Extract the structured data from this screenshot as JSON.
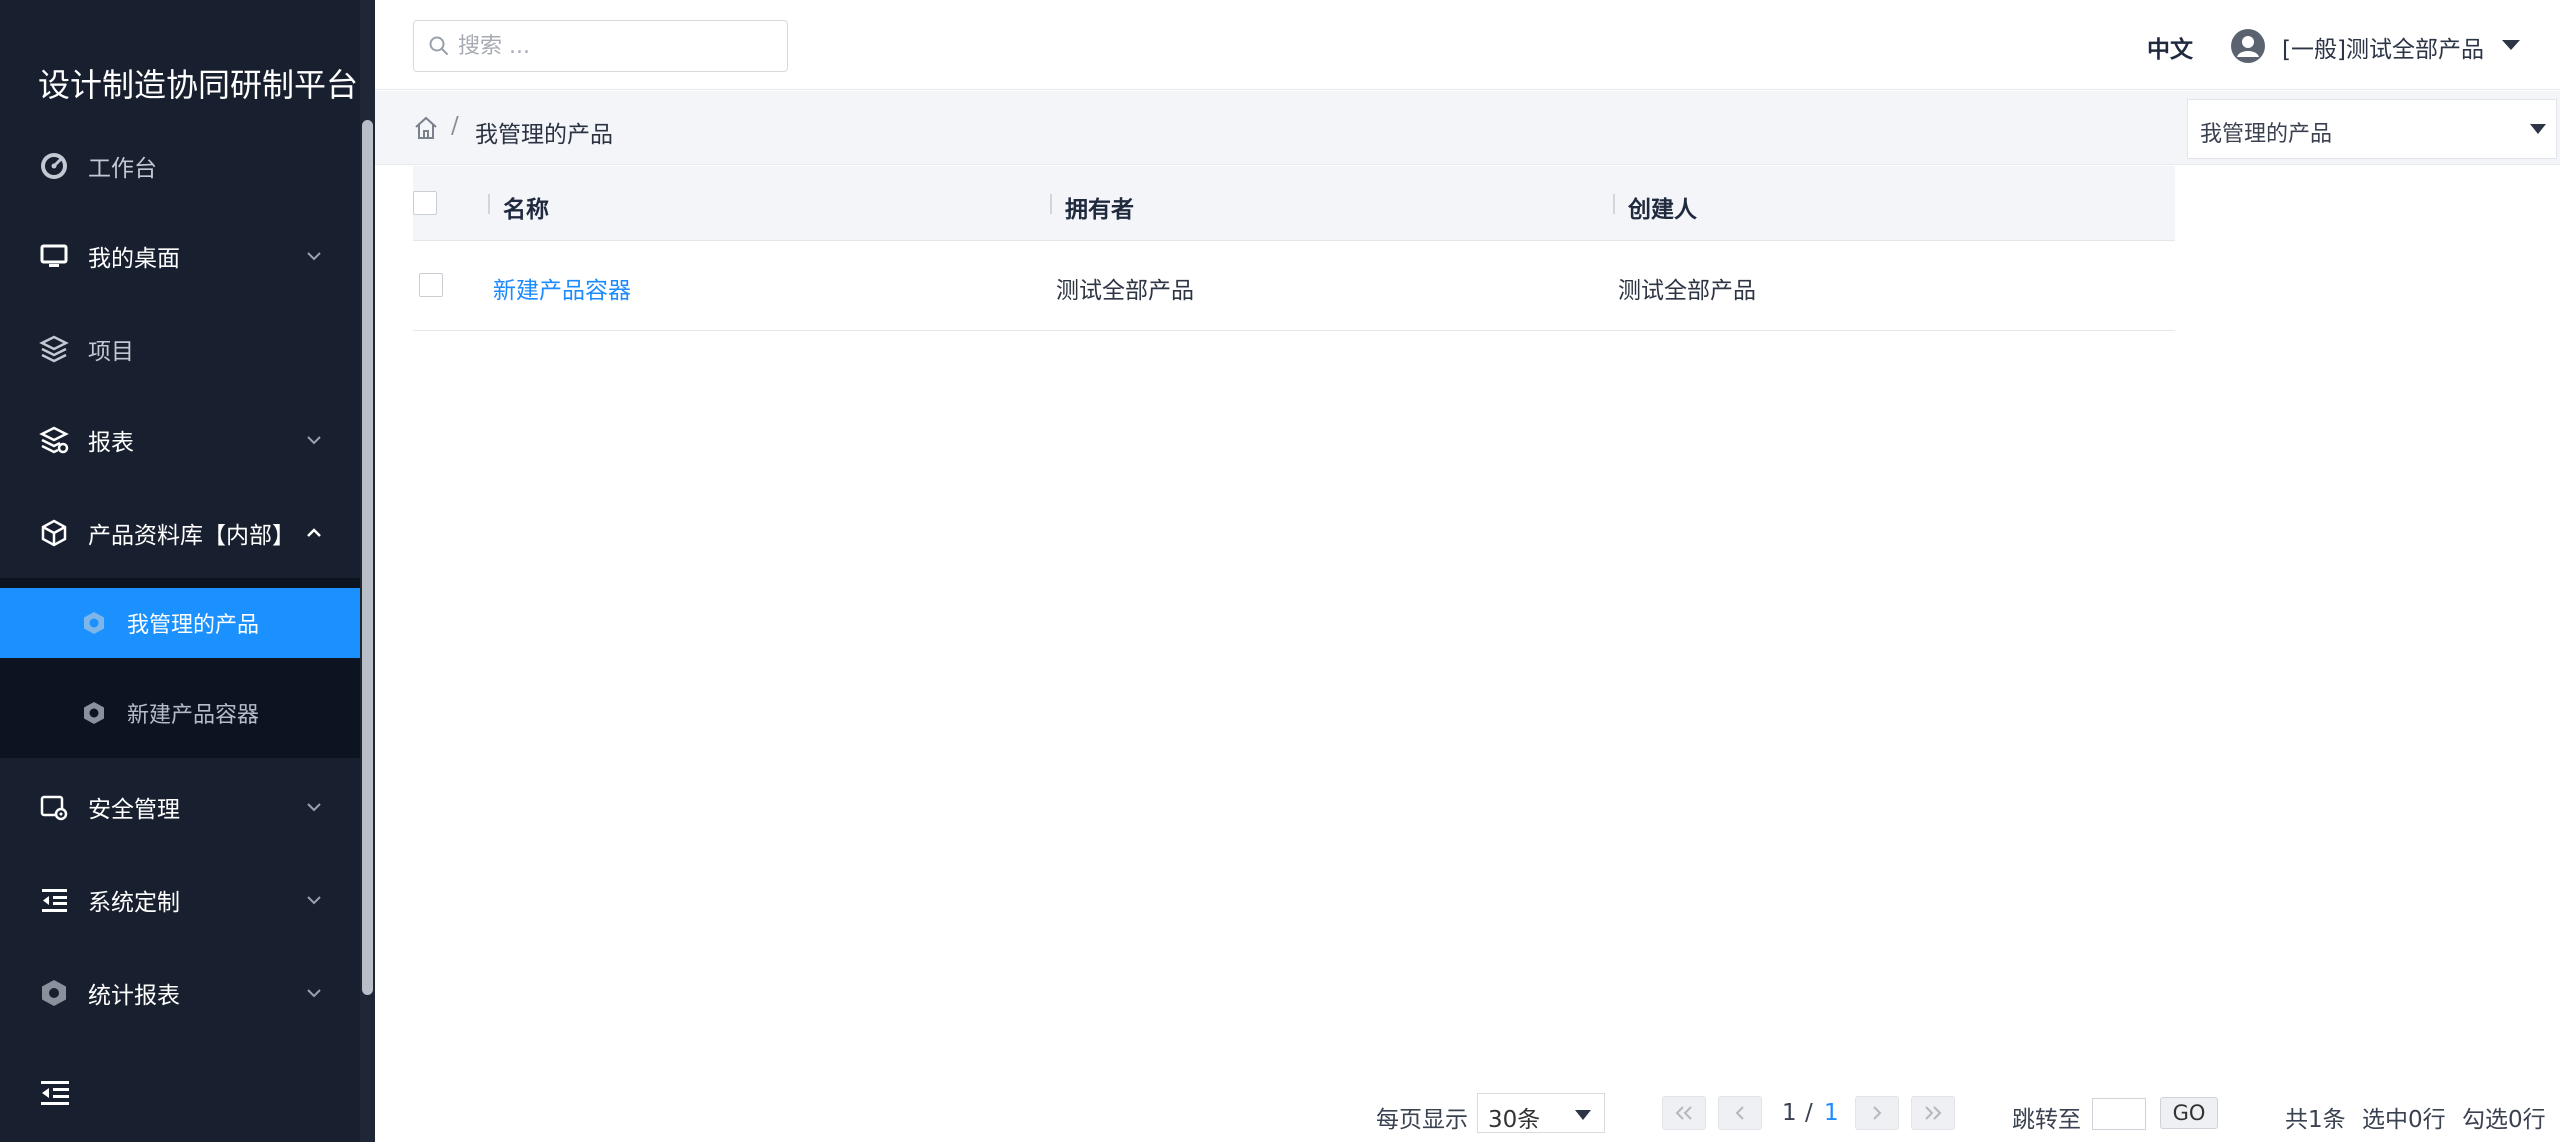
{
  "app": {
    "title": "设计制造协同研制平台"
  },
  "sidebar": {
    "items": [
      {
        "label": "工作台",
        "icon": "dashboard-icon"
      },
      {
        "label": "我的桌面",
        "icon": "monitor-icon",
        "expandable": true
      },
      {
        "label": "项目",
        "icon": "layers-icon"
      },
      {
        "label": "报表",
        "icon": "layers-gear-icon",
        "expandable": true
      },
      {
        "label": "产品资料库【内部】",
        "icon": "cube-icon",
        "expanded": true
      },
      {
        "label": "安全管理",
        "icon": "security-settings-icon",
        "expandable": true
      },
      {
        "label": "系统定制",
        "icon": "indent-list-icon",
        "expandable": true
      },
      {
        "label": "统计报表",
        "icon": "hexagon-icon",
        "expandable": true
      }
    ],
    "subitems": [
      {
        "label": "我管理的产品",
        "active": true
      },
      {
        "label": "新建产品容器",
        "active": false
      }
    ],
    "accent": "#1b91ff",
    "background": "#18202f"
  },
  "header": {
    "search_placeholder": "搜索 ...",
    "language": "中文",
    "user": "[一般]测试全部产品"
  },
  "breadcrumb": {
    "current": "我管理的产品",
    "separator": "/"
  },
  "view_select": {
    "selected": "我管理的产品"
  },
  "table": {
    "columns": [
      "名称",
      "拥有者",
      "创建人"
    ],
    "rows": [
      {
        "name": "新建产品容器",
        "owner": "测试全部产品",
        "creator": "测试全部产品"
      }
    ]
  },
  "pagination": {
    "per_page_label": "每页显示",
    "per_page_value": "30条",
    "current_page": "1",
    "page_separator": "/",
    "total_pages": "1",
    "jump_label": "跳转至",
    "go_label": "GO",
    "total_label": "共1条",
    "selected_label": "选中0行",
    "checked_label": "勾选0行"
  }
}
